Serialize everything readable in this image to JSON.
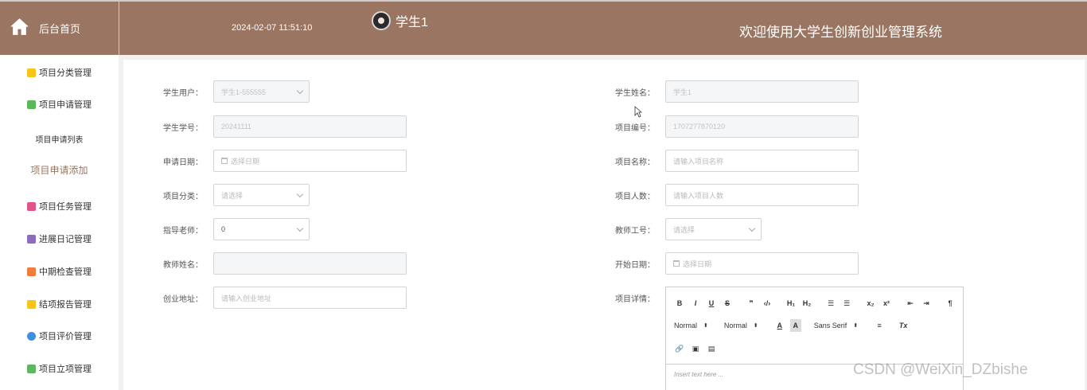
{
  "header": {
    "home_label": "后台首页",
    "datetime": "2024-02-07 11:51:10",
    "user_name": "学生1",
    "site_title": "欢迎使用大学生创新创业管理系统"
  },
  "sidebar": {
    "items": [
      {
        "label": "项目分类管理",
        "icon": "cube-icon",
        "color": "#f5c518"
      },
      {
        "label": "项目申请管理",
        "icon": "chat-icon",
        "color": "#5cb85c"
      },
      {
        "label": "项目申请列表"
      },
      {
        "label": "项目申请添加"
      },
      {
        "label": "项目任务管理",
        "icon": "clipboard-icon",
        "color": "#e0548a"
      },
      {
        "label": "进展日记管理",
        "icon": "archive-icon",
        "color": "#8e6bbf"
      },
      {
        "label": "中期检查管理",
        "icon": "grid-icon",
        "color": "#f07d3a"
      },
      {
        "label": "结项报告管理",
        "icon": "cube-icon",
        "color": "#f5c518"
      },
      {
        "label": "项目评价管理",
        "icon": "star-icon",
        "color": "#3f8fe0"
      },
      {
        "label": "项目立项管理",
        "icon": "chat-icon",
        "color": "#5cb85c"
      }
    ]
  },
  "form": {
    "student_user": {
      "label": "学生用户：",
      "value": "学生1-555555"
    },
    "student_name": {
      "label": "学生姓名：",
      "value": "学生1"
    },
    "student_no": {
      "label": "学生学号：",
      "value": "20241111"
    },
    "project_no": {
      "label": "项目编号：",
      "value": "1707277870120"
    },
    "apply_date": {
      "label": "申请日期：",
      "placeholder": "选择日期"
    },
    "project_name": {
      "label": "项目名称：",
      "placeholder": "请输入项目名称"
    },
    "project_category": {
      "label": "项目分类：",
      "placeholder": "请选择"
    },
    "project_members": {
      "label": "项目人数：",
      "placeholder": "请输入项目人数"
    },
    "advisor": {
      "label": "指导老师：",
      "value": "0"
    },
    "teacher_id": {
      "label": "教师工号：",
      "placeholder": "请选择"
    },
    "teacher_name": {
      "label": "教师姓名：",
      "value": ""
    },
    "start_date": {
      "label": "开始日期：",
      "placeholder": "选择日期"
    },
    "address": {
      "label": "创业地址：",
      "placeholder": "请输入创业地址"
    },
    "details": {
      "label": "项目详情："
    }
  },
  "editor": {
    "header_picker": "Normal",
    "size_picker": "Normal",
    "font_picker": "Sans Serif",
    "placeholder": "Insert text here ..."
  },
  "watermark": "CSDN @WeiXin_DZbishe"
}
